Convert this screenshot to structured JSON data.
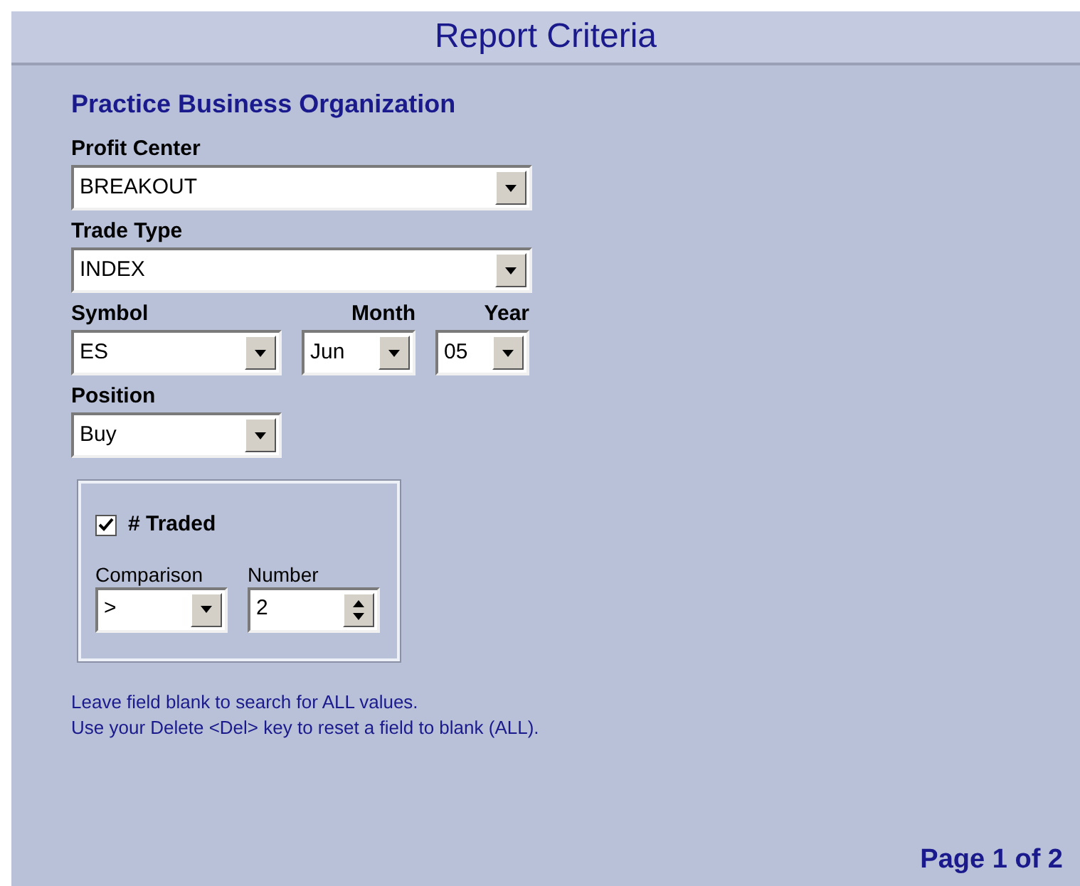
{
  "header": {
    "title": "Report Criteria"
  },
  "organization": "Practice Business Organization",
  "profit_center": {
    "label": "Profit Center",
    "value": "BREAKOUT"
  },
  "trade_type": {
    "label": "Trade Type",
    "value": "INDEX"
  },
  "symbol": {
    "label": "Symbol",
    "value": "ES"
  },
  "month": {
    "label": "Month",
    "value": "Jun"
  },
  "year": {
    "label": "Year",
    "value": "05"
  },
  "position": {
    "label": "Position",
    "value": "Buy"
  },
  "traded": {
    "label": "# Traded",
    "checked": true,
    "comparison": {
      "label": "Comparison",
      "value": ">"
    },
    "number": {
      "label": "Number",
      "value": "2"
    }
  },
  "notes": [
    "Leave field blank to search for ALL values.",
    "Use your Delete <Del> key to reset a field to blank (ALL)."
  ],
  "page_indicator": "Page 1 of 2"
}
